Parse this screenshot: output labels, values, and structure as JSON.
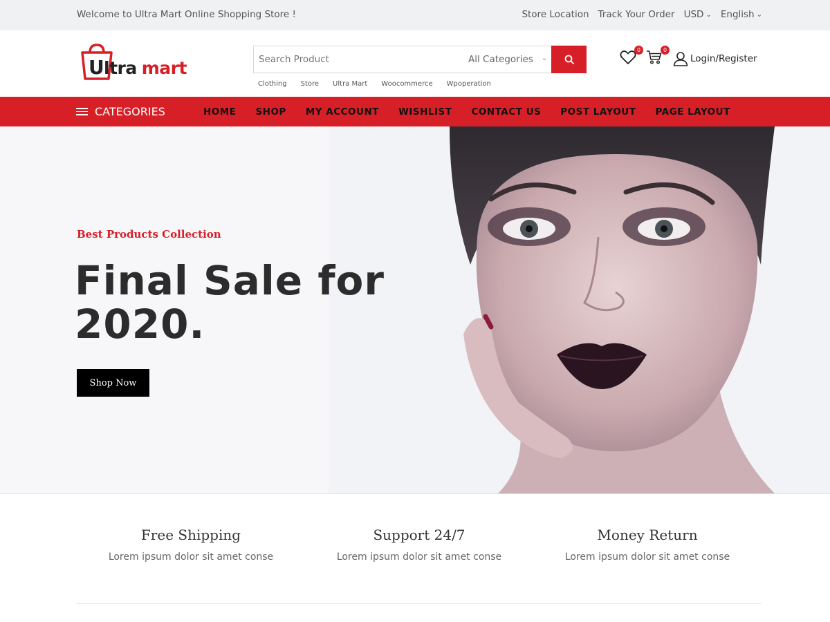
{
  "topbar": {
    "welcome": "Welcome to Ultra Mart Online Shopping Store !",
    "store_location": "Store Location",
    "track_order": "Track Your Order",
    "currency": "USD",
    "language": "English"
  },
  "header": {
    "logo": {
      "first": "ltra",
      "second": "mart",
      "initial": "U"
    },
    "search": {
      "placeholder": "Search Product",
      "category": "All Categories"
    },
    "tags": [
      "Clothing",
      "Store",
      "Ultra Mart",
      "Woocommerce",
      "Wpoperation"
    ],
    "wishlist_count": "0",
    "cart_count": "0",
    "login_label": "Login/Register"
  },
  "nav": {
    "categories_label": "CATEGORIES",
    "items": [
      "HOME",
      "SHOP",
      "MY ACCOUNT",
      "WISHLIST",
      "CONTACT US",
      "POST LAYOUT",
      "PAGE LAYOUT"
    ]
  },
  "hero": {
    "eyebrow": "Best Products Collection",
    "title": "Final Sale for 2020.",
    "button": "Shop Now"
  },
  "features": [
    {
      "title": "Free Shipping",
      "desc": "Lorem ipsum dolor sit amet conse"
    },
    {
      "title": "Support 24/7",
      "desc": "Lorem ipsum dolor sit amet conse"
    },
    {
      "title": "Money Return",
      "desc": "Lorem ipsum dolor sit amet conse"
    }
  ],
  "colors": {
    "accent": "#d71f27",
    "dark": "#222222",
    "topbar_bg": "#f0f1f3"
  }
}
